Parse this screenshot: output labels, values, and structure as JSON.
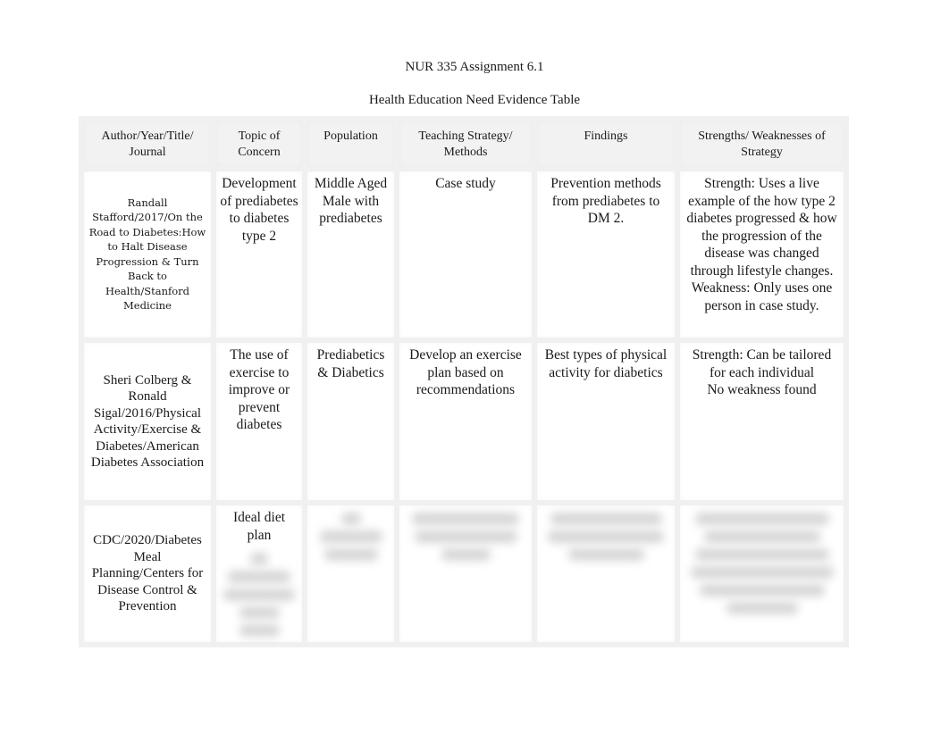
{
  "document": {
    "title": "NUR 335 Assignment 6.1",
    "subtitle": "Health Education Need Evidence Table"
  },
  "table": {
    "headers": [
      "Author/Year/Title/ Journal",
      "Topic of Concern",
      "Population",
      "Teaching Strategy/ Methods",
      "Findings",
      "Strengths/ Weaknesses of Strategy"
    ],
    "rows": [
      {
        "author": "Randall Stafford/2017/On the Road to Diabetes:How to Halt Disease Progression & Turn Back to Health/Stanford Medicine",
        "topic": "Development of prediabetes to diabetes type 2",
        "population": "Middle Aged Male with prediabetes",
        "strategy": "Case study",
        "findings": "Prevention methods from prediabetes to DM 2.",
        "strengths_weaknesses": "Strength: Uses a live example of the how type 2 diabetes progressed & how the progression of the disease was changed through lifestyle changes. Weakness: Only uses one person in case study."
      },
      {
        "author": "Sheri Colberg & Ronald Sigal/2016/Physical Activity/Exercise & Diabetes/American Diabetes Association",
        "topic": "The use of exercise to improve or prevent diabetes",
        "population": "Prediabetics & Diabetics",
        "strategy": "Develop an exercise plan based on recommendations",
        "findings": "Best types of physical activity for diabetics",
        "strengths_weaknesses_line1": "Strength: Can be tailored for each individual",
        "strengths_weaknesses_line2": "No weakness found"
      },
      {
        "author": "CDC/2020/Diabetes Meal Planning/Centers for Disease Control & Prevention",
        "topic": "Ideal diet plan",
        "topic_obscured": true,
        "population_obscured": true,
        "strategy_obscured": true,
        "findings_obscured": true,
        "strengths_weaknesses_obscured": true
      }
    ]
  }
}
